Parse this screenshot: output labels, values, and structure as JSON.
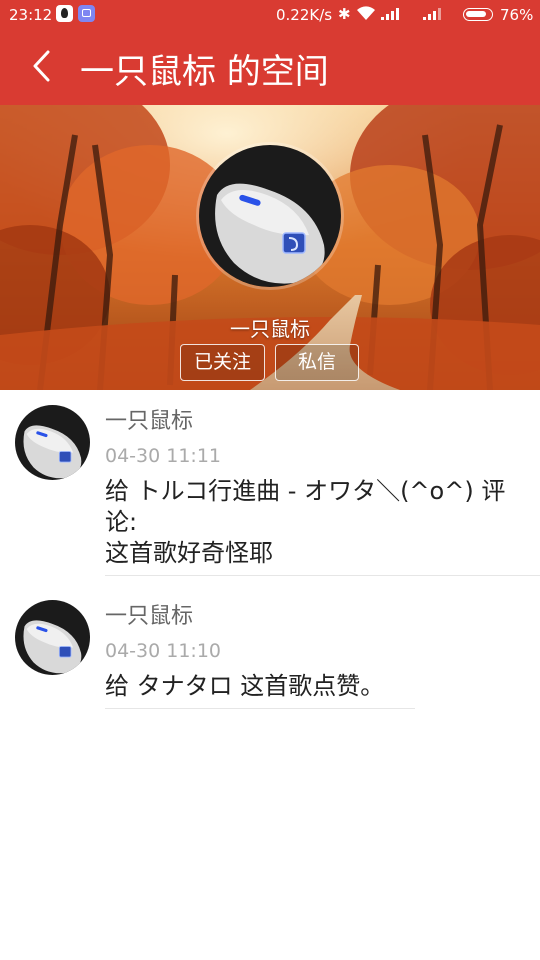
{
  "status_bar": {
    "time": "23:12",
    "network_speed": "0.22K/s",
    "battery": "76%"
  },
  "title_bar": {
    "title": "一只鼠标 的空间"
  },
  "profile": {
    "name": "一只鼠标",
    "follow_label": "已关注",
    "message_label": "私信"
  },
  "feed": [
    {
      "username": "一只鼠标",
      "time": "04-30 11:11",
      "content": "给 トルコ行進曲 - オワタ＼(^o^) 评论:\n这首歌好奇怪耶"
    },
    {
      "username": "一只鼠标",
      "time": "04-30 11:10",
      "content": "给 タナタロ 这首歌点赞。"
    }
  ],
  "colors": {
    "accent": "#d93b32",
    "username": "#666666",
    "timestamp": "#aaaaaa",
    "content": "#222222"
  },
  "icons": {
    "back": "back-arrow-icon",
    "bluetooth": "bluetooth-icon",
    "wifi": "wifi-icon",
    "signal": "signal-icon",
    "battery": "battery-icon"
  }
}
